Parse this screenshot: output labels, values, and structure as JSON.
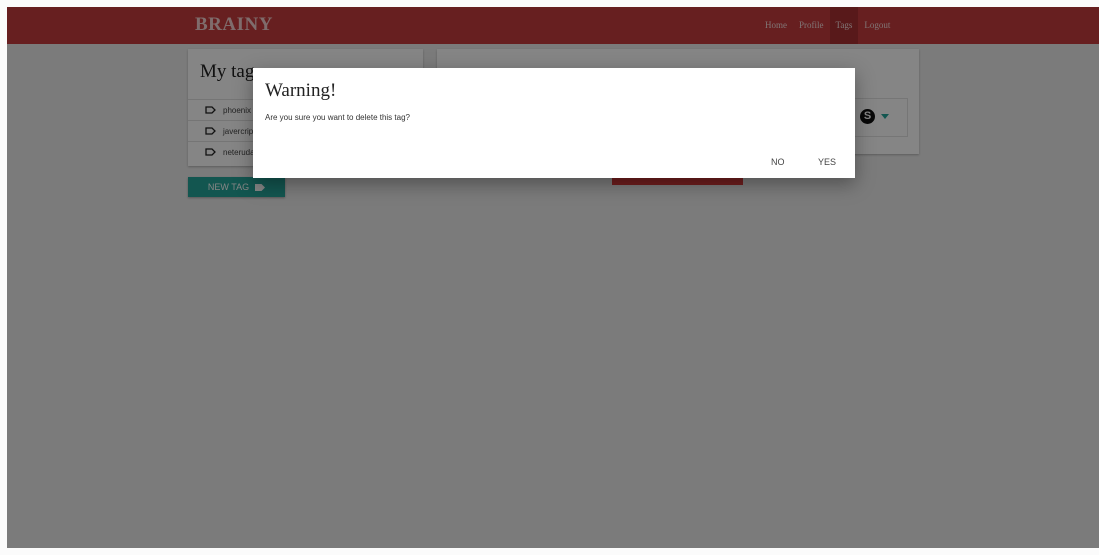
{
  "navbar": {
    "brand": "BRAINY",
    "items": [
      {
        "label": "Home",
        "active": false
      },
      {
        "label": "Profile",
        "active": false
      },
      {
        "label": "Tags",
        "active": true
      },
      {
        "label": "Logout",
        "active": false
      }
    ],
    "color": "#c63c3e"
  },
  "tags": {
    "title": "My tags",
    "items": [
      {
        "label": "phoenix",
        "icon": "tag-outline-icon"
      },
      {
        "label": "javercript",
        "icon": "tag-outline-icon"
      },
      {
        "label": "neteruda",
        "icon": "tag-outline-icon"
      }
    ],
    "new_tag_label": "NEW TAG",
    "new_tag_icon": "tag-icon",
    "accent": "#26a69a"
  },
  "share": {
    "icons": [
      "skype-icon",
      "dropdown-icon"
    ],
    "skype_glyph": "S"
  },
  "modal": {
    "title": "Warning!",
    "message": "Are you sure you want to delete this tag?",
    "no_label": "NO",
    "yes_label": "YES"
  },
  "colors": {
    "overlay": "rgba(0,0,0,0.48)",
    "danger": "#d63a3a"
  }
}
